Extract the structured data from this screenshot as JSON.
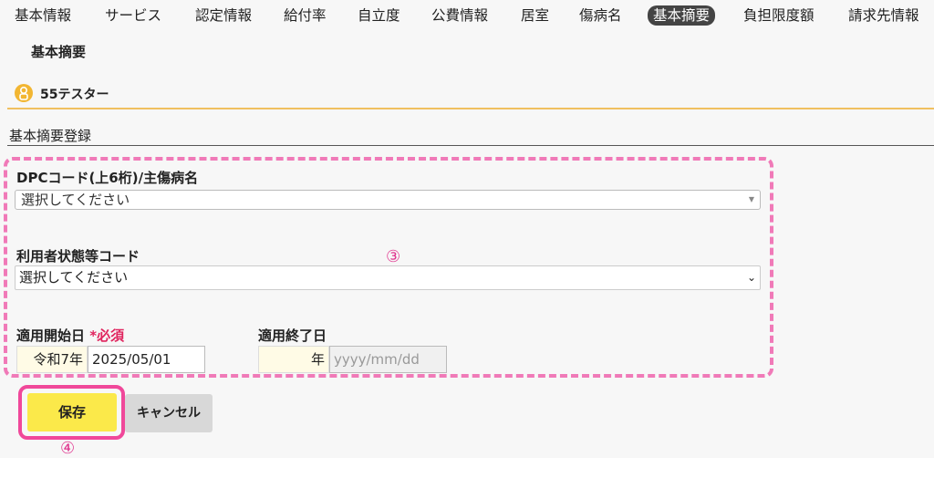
{
  "tabs": [
    {
      "label": "基本情報",
      "active": false
    },
    {
      "label": "サービス",
      "active": false
    },
    {
      "label": "認定情報",
      "active": false
    },
    {
      "label": "給付率",
      "active": false
    },
    {
      "label": "自立度",
      "active": false
    },
    {
      "label": "公費情報",
      "active": false
    },
    {
      "label": "居室",
      "active": false
    },
    {
      "label": "傷病名",
      "active": false
    },
    {
      "label": "基本摘要",
      "active": true
    },
    {
      "label": "負担限度額",
      "active": false
    },
    {
      "label": "請求先情報",
      "active": false
    }
  ],
  "section_title": "基本摘要",
  "user": {
    "name": "55テスター",
    "icon": "user-icon"
  },
  "form": {
    "title": "基本摘要登録",
    "dpc_label": "DPCコード(上6桁)/主傷病名",
    "dpc_value": "選択してください",
    "status_label": "利用者状態等コード",
    "status_value": "選択してください",
    "start_label": "適用開始日",
    "required_mark": "*必須",
    "start_era": "令和7年",
    "start_date": "2025/05/01",
    "end_label": "適用終了日",
    "end_era": "年",
    "end_placeholder": "yyyy/mm/dd"
  },
  "buttons": {
    "save": "保存",
    "cancel": "キャンセル"
  },
  "annotations": {
    "form_marker": "③",
    "save_marker": "④"
  },
  "colors": {
    "accent_yellow": "#fbe94a",
    "highlight_pink": "#f0489a",
    "active_tab": "#444444"
  }
}
